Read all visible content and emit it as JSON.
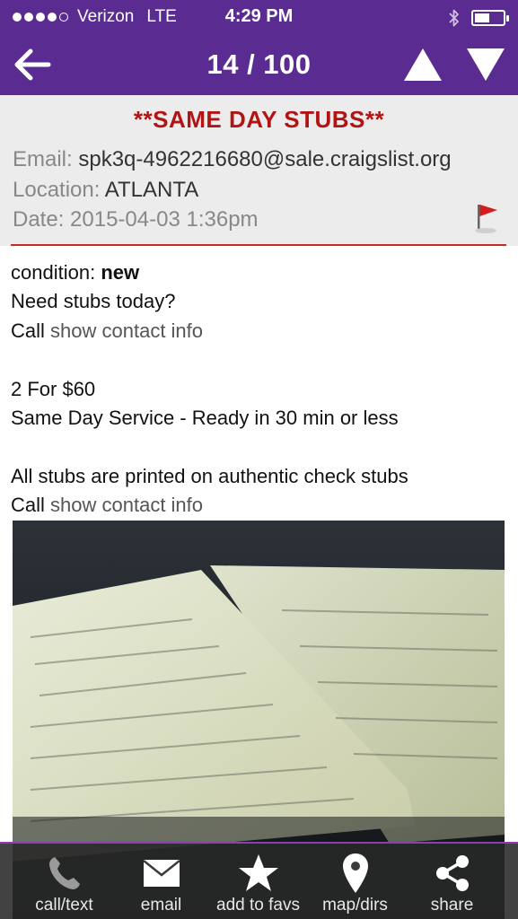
{
  "status_bar": {
    "carrier": "Verizon",
    "network": "LTE",
    "time": "4:29 PM"
  },
  "nav": {
    "counter": "14 / 100"
  },
  "header": {
    "title": "**SAME DAY STUBS**",
    "email_label": "Email:",
    "email_value": "spk3q-4962216680@sale.craigslist.org",
    "location_label": "Location:",
    "location_value": "ATLANTA",
    "date_label": "Date:",
    "date_value": "2015-04-03 1:36pm"
  },
  "body": {
    "condition_label": "condition:",
    "condition_value": "new",
    "line1": "Need stubs today?",
    "call1_prefix": "Call",
    "call1_link": "show contact info",
    "line2": "2 For $60",
    "line3": "Same Day Service - Ready in 30 min or less",
    "line4": "All stubs are printed on authentic check stubs",
    "call2_prefix": "Call",
    "call2_link": "show contact info"
  },
  "toolbar": {
    "items": [
      {
        "label": "call/text",
        "icon": "phone-icon"
      },
      {
        "label": "email",
        "icon": "envelope-icon"
      },
      {
        "label": "add to favs",
        "icon": "star-icon"
      },
      {
        "label": "map/dirs",
        "icon": "map-pin-icon"
      },
      {
        "label": "share",
        "icon": "share-icon"
      }
    ]
  },
  "colors": {
    "nav_purple": "#5a2c91",
    "title_red": "#b21414",
    "rule_red": "#c42a2a",
    "toolbar_bg": "#282828"
  }
}
